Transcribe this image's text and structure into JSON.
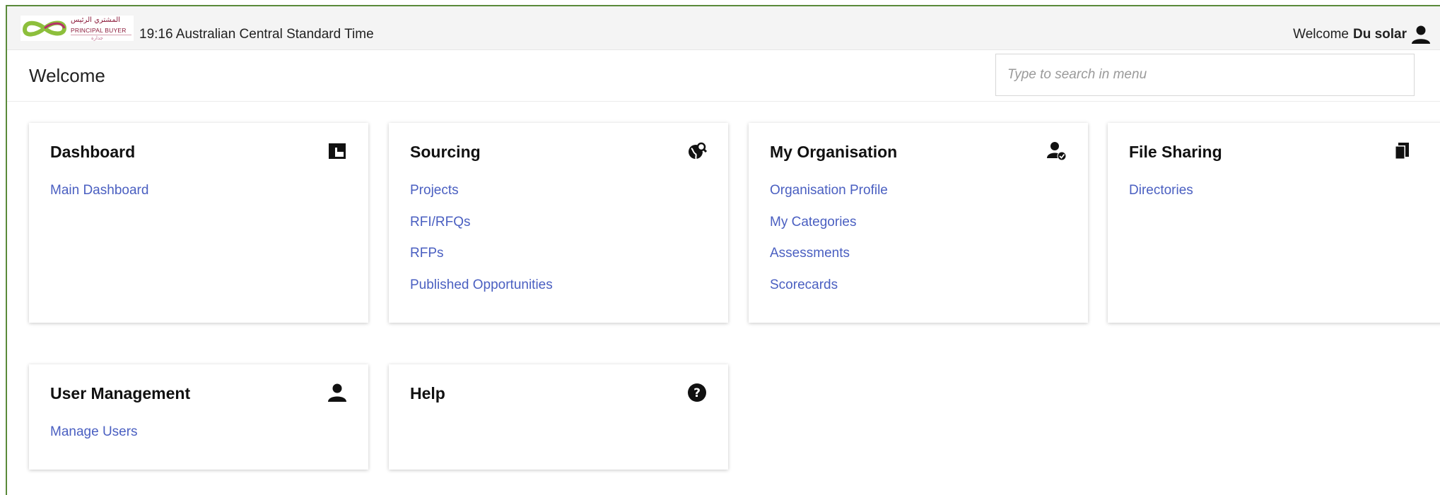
{
  "header": {
    "logo": {
      "arabic": "المشتري الرئيس",
      "english": "PRINCIPAL BUYER",
      "arabic_small": "جدارة"
    },
    "clock_text": "19:16 Australian Central Standard Time",
    "welcome_label": "Welcome",
    "user_name": "Du solar"
  },
  "page": {
    "title": "Welcome",
    "search_placeholder": "Type to search in menu"
  },
  "cards": [
    {
      "title": "Dashboard",
      "icon": "dashboard-icon",
      "links": [
        "Main Dashboard"
      ]
    },
    {
      "title": "Sourcing",
      "icon": "globe-search-icon",
      "links": [
        "Projects",
        "RFI/RFQs",
        "RFPs",
        "Published Opportunities"
      ]
    },
    {
      "title": "My Organisation",
      "icon": "user-check-icon",
      "links": [
        "Organisation Profile",
        "My Categories",
        "Assessments",
        "Scorecards"
      ]
    },
    {
      "title": "File Sharing",
      "icon": "copy-files-icon",
      "links": [
        "Directories"
      ]
    },
    {
      "title": "User Management",
      "icon": "user-icon",
      "links": [
        "Manage Users"
      ]
    },
    {
      "title": "Help",
      "icon": "help-icon",
      "links": []
    }
  ],
  "colors": {
    "link": "#4a5fc1",
    "frame_border": "#5a8a3a",
    "topbar_bg": "#f4f4f4"
  }
}
